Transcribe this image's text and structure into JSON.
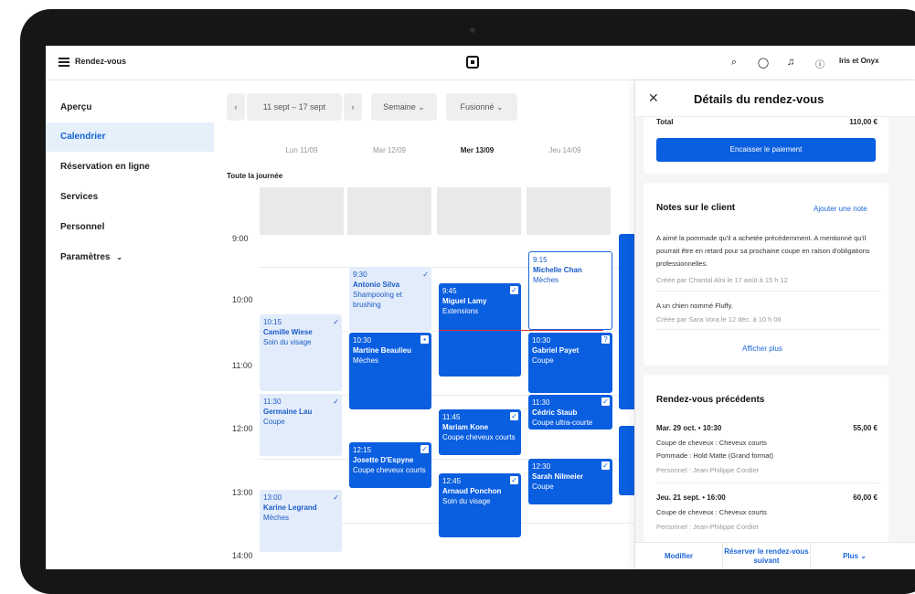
{
  "topbar": {
    "title": "Rendez-vous",
    "account": "Iris et Onyx"
  },
  "sidebar": {
    "items": [
      {
        "label": "Aperçu"
      },
      {
        "label": "Calendrier"
      },
      {
        "label": "Réservation en ligne"
      },
      {
        "label": "Services"
      },
      {
        "label": "Personnel"
      },
      {
        "label": "Paramètres"
      }
    ]
  },
  "toolbar": {
    "prev": "‹",
    "range": "11 sept – 17 sept",
    "next": "›",
    "view": "Semaine",
    "mode": "Fusionné"
  },
  "calendar": {
    "days": [
      "Lun 11/09",
      "Mar 12/09",
      "Mer 13/09",
      "Jeu 14/09"
    ],
    "current_day": "Mer 13/09",
    "all_day_label": "Toute la journée",
    "hours": [
      "9:00",
      "10:00",
      "11:00",
      "12:00",
      "13:00",
      "14:00"
    ],
    "events": [
      {
        "time": "10:15",
        "name": "Camille Wiese",
        "service": "Soin du visage"
      },
      {
        "time": "11:30",
        "name": "Germaine Lau",
        "service": "Coupe"
      },
      {
        "time": "13:00",
        "name": "Karine Legrand",
        "service": "Mèches"
      },
      {
        "time": "9:30",
        "name": "Antonio Silva",
        "service": "Shampooing et brushing"
      },
      {
        "time": "10:30",
        "name": "Martine Beaulieu",
        "service": "Mèches"
      },
      {
        "time": "12:15",
        "name": "Josette D'Espyne",
        "service": "Coupe cheveux courts"
      },
      {
        "time": "9:45",
        "name": "Miguel Lamy",
        "service": "Extensions"
      },
      {
        "time": "11:45",
        "name": "Mariam Kone",
        "service": "Coupe cheveux courts"
      },
      {
        "time": "12:45",
        "name": "Arnaud Ponchon",
        "service": "Soin du visage"
      },
      {
        "time": "9:15",
        "name": "Michelle Chan",
        "service": "Mèches"
      },
      {
        "time": "10:30",
        "name": "Gabriel Payet",
        "service": "Coupe"
      },
      {
        "time": "11:30",
        "name": "Cédric Staub",
        "service": "Coupe ultra-courte"
      },
      {
        "time": "12:30",
        "name": "Sarah Nilmeier",
        "service": "Coupe"
      }
    ]
  },
  "panel": {
    "title": "Détails du rendez-vous",
    "total_label": "Total",
    "total_value": "110,00 €",
    "pay_button": "Encaisser le paiement",
    "notes": {
      "title": "Notes sur le client",
      "add_link": "Ajouter une note",
      "note1": "A aimé la pommade qu'il a achetée précédemment. A mentionné qu'il pourrait être en retard pour sa prochaine coupe en raison d'obligations professionnelles.",
      "note1_meta": "Créée par Chantal Alni le 17 août à 15 h 12",
      "note2": "A un chien nommé Fluffy.",
      "note2_meta": "Créée par Sara Vora le 12 déc. à 10 h 06",
      "show_more": "Afficher plus"
    },
    "previous": {
      "title": "Rendez-vous précédents",
      "items": [
        {
          "date": "Mar. 29 oct.  •  10:30",
          "amount": "55,00 €",
          "line1": "Coupe de cheveux : Cheveux courts",
          "line2": "Pommade : Hold Matte (Grand format)",
          "staff": "Personnel : Jean-Philippe Cordier"
        },
        {
          "date": "Jeu. 21 sept.  •  16:00",
          "amount": "60,00 €",
          "line1": "Coupe de cheveux : Cheveux courts",
          "line2": "",
          "staff": "Personnel : Jean-Philippe Cordier"
        }
      ]
    },
    "footer": {
      "edit": "Modifier",
      "rebook": "Réserver le rendez-vous suivant",
      "more": "Plus"
    }
  }
}
